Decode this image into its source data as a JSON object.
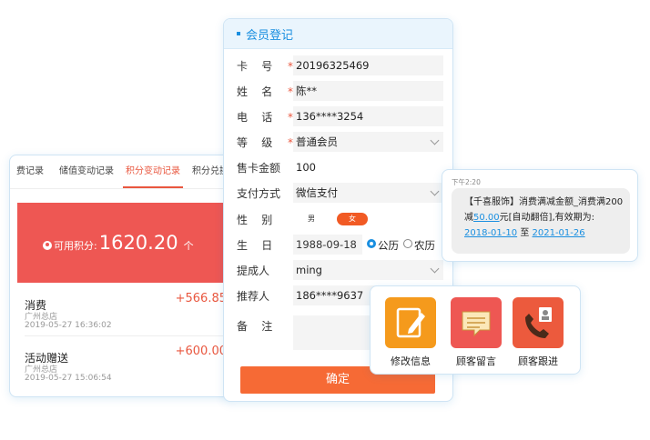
{
  "points_panel": {
    "tabs": [
      "费记录",
      "储值变动记录",
      "积分变动记录",
      "积分兑换记录"
    ],
    "active_tab": 2,
    "available_label": "可用积分:",
    "available_value": "1620.20",
    "available_unit": "个",
    "records": [
      {
        "title": "消费",
        "store": "广州总店",
        "time": "2019-05-27 16:36:02",
        "amount": "+566.85"
      },
      {
        "title": "活动赠送",
        "store": "广州总店",
        "time": "2019-05-27 15:06:54",
        "amount": "+600.00"
      }
    ],
    "accent_color": "#ee5753"
  },
  "member_form": {
    "title": "会员登记",
    "fields": {
      "card_no": {
        "label": "卡    号",
        "value": "20196325469"
      },
      "name": {
        "label": "姓    名",
        "value": "陈**"
      },
      "phone": {
        "label": "电    话",
        "value": "136****3254"
      },
      "level": {
        "label": "等    级",
        "value": "普通会员"
      },
      "card_amount": {
        "label": "售卡金额",
        "value": "100"
      },
      "payment": {
        "label": "支付方式",
        "value": "微信支付"
      },
      "gender": {
        "label": "性    别",
        "male": "男",
        "female": "女"
      },
      "birthday": {
        "label": "生    日",
        "value": "1988-09-18",
        "calendar_solar": "公历",
        "calendar_lunar": "农历"
      },
      "referrer_person": {
        "label": "提成人",
        "value": "ming"
      },
      "recommender": {
        "label": "推荐人",
        "value": "186****9637"
      },
      "remark": {
        "label": "备    注",
        "value": ""
      }
    },
    "confirm_label": "确定",
    "header_color": "#1a8fe0",
    "button_color": "#f66a35"
  },
  "sms": {
    "time": "下午2:20",
    "text_prefix": "【千喜服饰】消费满减金额_消费满200减",
    "amount": "50.00",
    "text_mid": "元[自动翻倍],有效期为:",
    "date_from": "2018-01-10",
    "to": "至",
    "date_to": "2021-01-26"
  },
  "actions": [
    {
      "label": "修改信息",
      "icon": "edit-icon"
    },
    {
      "label": "顾客留言",
      "icon": "message-icon"
    },
    {
      "label": "顾客跟进",
      "icon": "phone-icon"
    }
  ]
}
